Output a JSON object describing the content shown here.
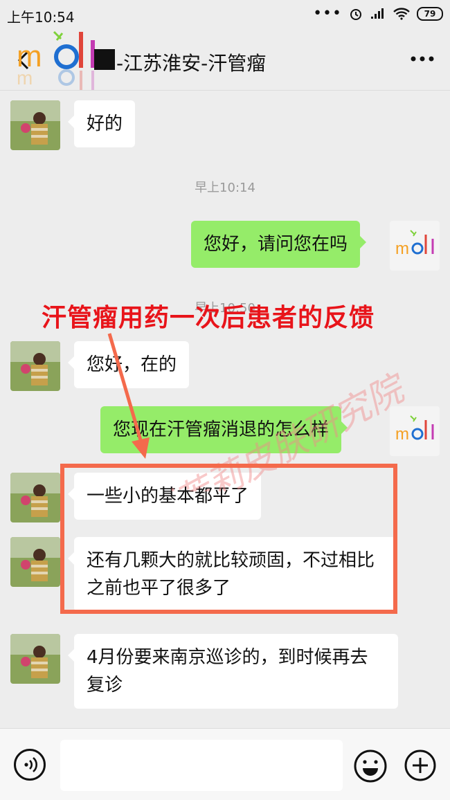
{
  "status_bar": {
    "time": "上午10:54",
    "battery": "79",
    "dots": "•••"
  },
  "header": {
    "title": "-江苏淮安-汗管瘤",
    "logo_text": "moli",
    "back_icon": "chevron-left-icon",
    "menu_icon": "more-dots-icon"
  },
  "messages": [
    {
      "side": "in",
      "text": "好的"
    },
    {
      "type": "time",
      "text": "早上10:14"
    },
    {
      "side": "out",
      "text": "您好，请问您在吗"
    },
    {
      "type": "time",
      "text": "早上10:50"
    },
    {
      "side": "in",
      "text": "您好，在的"
    },
    {
      "side": "out",
      "text": "您现在汗管瘤消退的怎么样"
    },
    {
      "side": "in",
      "text": "一些小的基本都平了"
    },
    {
      "side": "in",
      "text": "还有几颗大的就比较顽固，不过相比之前也平了很多了"
    },
    {
      "side": "in",
      "text": "4月份要来南京巡诊的，到时候再去复诊"
    }
  ],
  "overlay": {
    "annotation": "汗管瘤用药一次后患者的反馈",
    "watermark": "深圳茉莉皮肤研究院",
    "colors": {
      "annotation": "#e8141a",
      "box": "#f46a4c"
    }
  },
  "input_bar": {
    "voice_icon": "voice-icon",
    "emoji_icon": "emoji-icon",
    "plus_icon": "plus-icon",
    "placeholder": ""
  },
  "colors": {
    "bubble_in": "#ffffff",
    "bubble_out": "#95ec69",
    "background": "#ededed"
  }
}
